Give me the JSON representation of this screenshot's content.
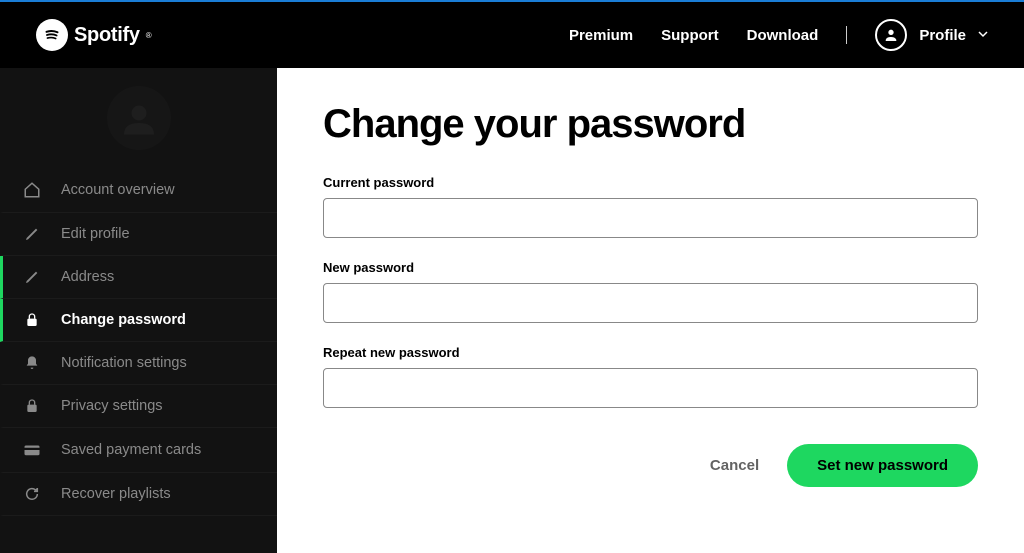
{
  "brand": "Spotify",
  "nav": {
    "premium": "Premium",
    "support": "Support",
    "download": "Download",
    "profile": "Profile"
  },
  "sidebar": {
    "items": [
      {
        "label": "Account overview"
      },
      {
        "label": "Edit profile"
      },
      {
        "label": "Address"
      },
      {
        "label": "Change password"
      },
      {
        "label": "Notification settings"
      },
      {
        "label": "Privacy settings"
      },
      {
        "label": "Saved payment cards"
      },
      {
        "label": "Recover playlists"
      }
    ]
  },
  "main": {
    "title": "Change your password",
    "current_label": "Current password",
    "new_label": "New password",
    "repeat_label": "Repeat new password",
    "cancel": "Cancel",
    "submit": "Set new password"
  }
}
